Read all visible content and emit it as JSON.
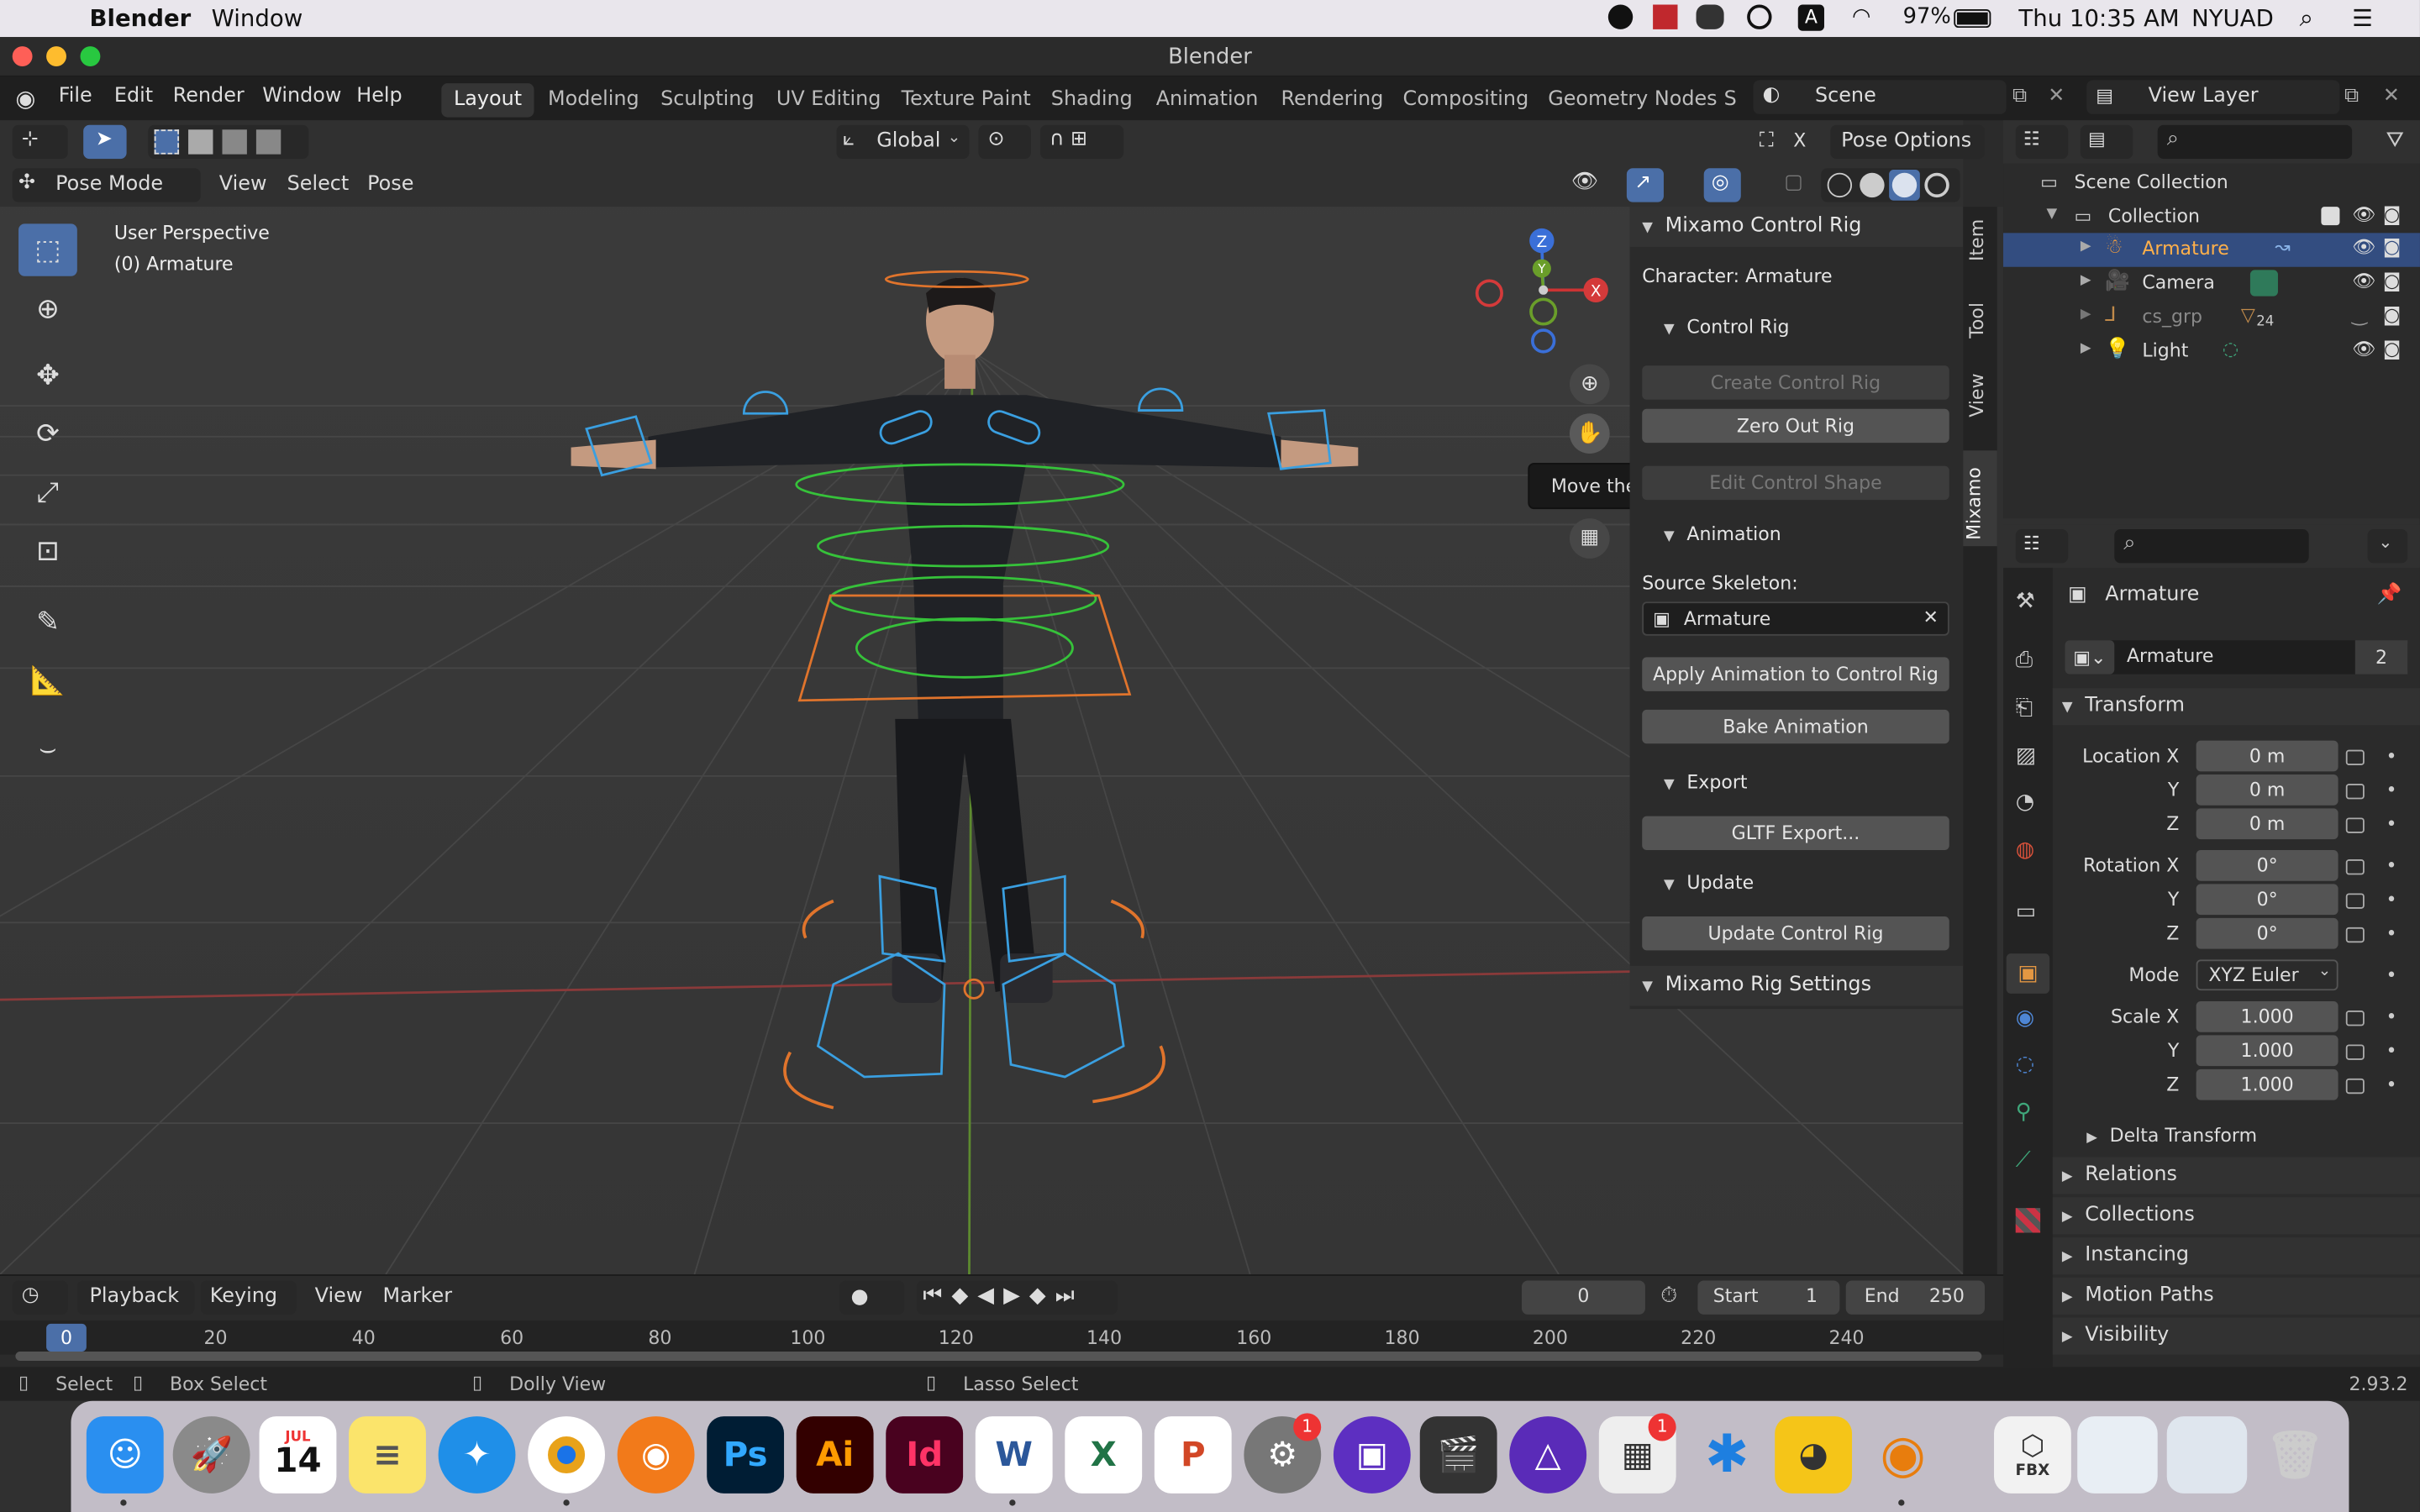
{
  "menubar": {
    "app": "Blender",
    "window": "Window",
    "battery": "97%",
    "clock": "Thu 10:35 AM",
    "user": "NYUAD"
  },
  "titlebar": {
    "title": "Blender"
  },
  "topmenu": [
    "File",
    "Edit",
    "Render",
    "Window",
    "Help"
  ],
  "workspaces": [
    "Layout",
    "Modeling",
    "Sculpting",
    "UV Editing",
    "Texture Paint",
    "Shading",
    "Animation",
    "Rendering",
    "Compositing",
    "Geometry Nodes",
    "S"
  ],
  "scene": {
    "label": "Scene",
    "viewlayer": "View Layer"
  },
  "viewport": {
    "mode": "Pose Mode",
    "menus": [
      "View",
      "Select",
      "Pose"
    ],
    "orientation": "Global",
    "pose_options": "Pose Options",
    "perspective": "User Perspective",
    "object": "(0) Armature",
    "tooltip": "Move the view",
    "axis_x": "X",
    "axis_y": "Y",
    "axis_z": "Z"
  },
  "npanel": {
    "title": "Mixamo Control Rig",
    "character": "Character: Armature",
    "control_rig": "Control Rig",
    "create": "Create Control Rig",
    "zero": "Zero Out Rig",
    "edit_shape": "Edit Control Shape",
    "animation": "Animation",
    "source_skeleton": "Source Skeleton:",
    "source_value": "Armature",
    "apply": "Apply Animation to Control Rig",
    "bake": "Bake Animation",
    "export": "Export",
    "gltf": "GLTF Export...",
    "update": "Update",
    "update_rig": "Update Control Rig",
    "rig_settings": "Mixamo Rig Settings",
    "tabs": [
      "Item",
      "Tool",
      "View",
      "Mixamo"
    ]
  },
  "outliner": {
    "scene_collection": "Scene Collection",
    "collection": "Collection",
    "items": [
      {
        "name": "Armature",
        "selected": true
      },
      {
        "name": "Camera"
      },
      {
        "name": "cs_grp",
        "badge": "24"
      },
      {
        "name": "Light"
      }
    ]
  },
  "properties": {
    "object": "Armature",
    "data_name": "Armature",
    "users": "2",
    "transform": "Transform",
    "location_label": "Location X",
    "location": [
      "0 m",
      "0 m",
      "0 m"
    ],
    "rotation_label": "Rotation X",
    "rotation": [
      "0°",
      "0°",
      "0°"
    ],
    "mode_label": "Mode",
    "mode": "XYZ Euler",
    "scale_label": "Scale X",
    "scale": [
      "1.000",
      "1.000",
      "1.000"
    ],
    "y": "Y",
    "z": "Z",
    "delta": "Delta Transform",
    "sections": [
      "Relations",
      "Collections",
      "Instancing",
      "Motion Paths",
      "Visibility"
    ]
  },
  "timeline": {
    "menus": [
      "Playback",
      "Keying",
      "View",
      "Marker"
    ],
    "frame": "0",
    "start_label": "Start",
    "start": "1",
    "end_label": "End",
    "end": "250",
    "ticks": [
      "0",
      "20",
      "40",
      "60",
      "80",
      "100",
      "120",
      "140",
      "160",
      "180",
      "200",
      "220",
      "240"
    ]
  },
  "statusbar": {
    "select": "Select",
    "box": "Box Select",
    "dolly": "Dolly View",
    "lasso": "Lasso Select",
    "version": "2.93.2"
  },
  "dock": {
    "calendar_month": "JUL",
    "calendar_day": "14",
    "badge1": "1",
    "badge2": "1",
    "fbx": "FBX"
  }
}
